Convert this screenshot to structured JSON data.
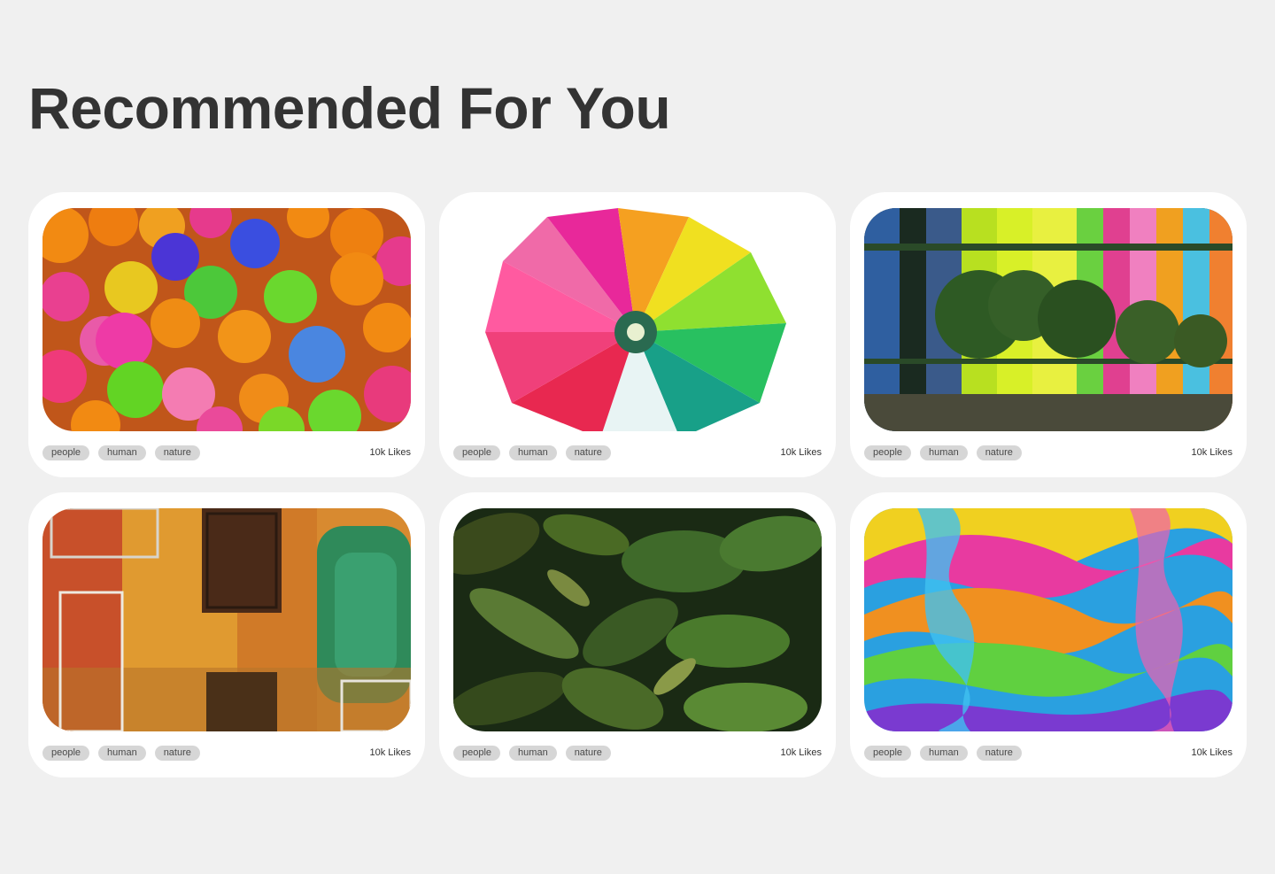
{
  "page": {
    "title": "Recommended For You"
  },
  "cards": [
    {
      "image_subject": "colorful ball pit",
      "tags": [
        "people",
        "human",
        "nature"
      ],
      "likes": "10k Likes"
    },
    {
      "image_subject": "rainbow chrysanthemum",
      "tags": [
        "people",
        "human",
        "nature"
      ],
      "likes": "10k Likes"
    },
    {
      "image_subject": "colored glass facade with trees",
      "tags": [
        "people",
        "human",
        "nature"
      ],
      "likes": "10k Likes"
    },
    {
      "image_subject": "painted wall with iron grilles",
      "tags": [
        "people",
        "human",
        "nature"
      ],
      "likes": "10k Likes"
    },
    {
      "image_subject": "green foliage",
      "tags": [
        "people",
        "human",
        "nature"
      ],
      "likes": "10k Likes"
    },
    {
      "image_subject": "iridescent marbled swirls",
      "tags": [
        "people",
        "human",
        "nature"
      ],
      "likes": "10k Likes"
    }
  ],
  "colors": {
    "background": "#f0f0f0",
    "card": "#ffffff",
    "tag": "#d6d6d6",
    "title": "#333333"
  }
}
